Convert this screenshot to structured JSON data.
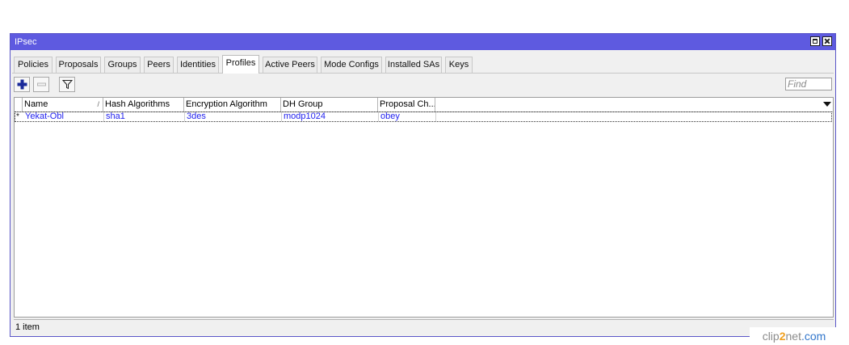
{
  "window": {
    "title": "IPsec"
  },
  "tabs": [
    {
      "label": "Policies"
    },
    {
      "label": "Proposals"
    },
    {
      "label": "Groups"
    },
    {
      "label": "Peers"
    },
    {
      "label": "Identities"
    },
    {
      "label": "Profiles",
      "active": true
    },
    {
      "label": "Active Peers"
    },
    {
      "label": "Mode Configs"
    },
    {
      "label": "Installed SAs"
    },
    {
      "label": "Keys"
    }
  ],
  "toolbar": {
    "add_icon": "plus-icon",
    "remove_icon": "minus-icon",
    "filter_icon": "filter-icon",
    "find_placeholder": "Find"
  },
  "table": {
    "columns": [
      "Name",
      "Hash Algorithms",
      "Encryption Algorithm",
      "DH Group",
      "Proposal Ch..."
    ],
    "sort_mark": "/",
    "rows": [
      {
        "flag": "*",
        "name": "Yekat-Obl",
        "hash": "sha1",
        "enc": "3des",
        "dh": "modp1024",
        "proposal_check": "obey"
      }
    ]
  },
  "status": {
    "text": "1 item"
  },
  "watermark": {
    "part1": "clip",
    "part2": "2",
    "part3": "net",
    "part4": ".com"
  },
  "colors": {
    "titlebar": "#5e5ae0",
    "row_text": "#2222ee",
    "plus": "#1a2a9a"
  }
}
